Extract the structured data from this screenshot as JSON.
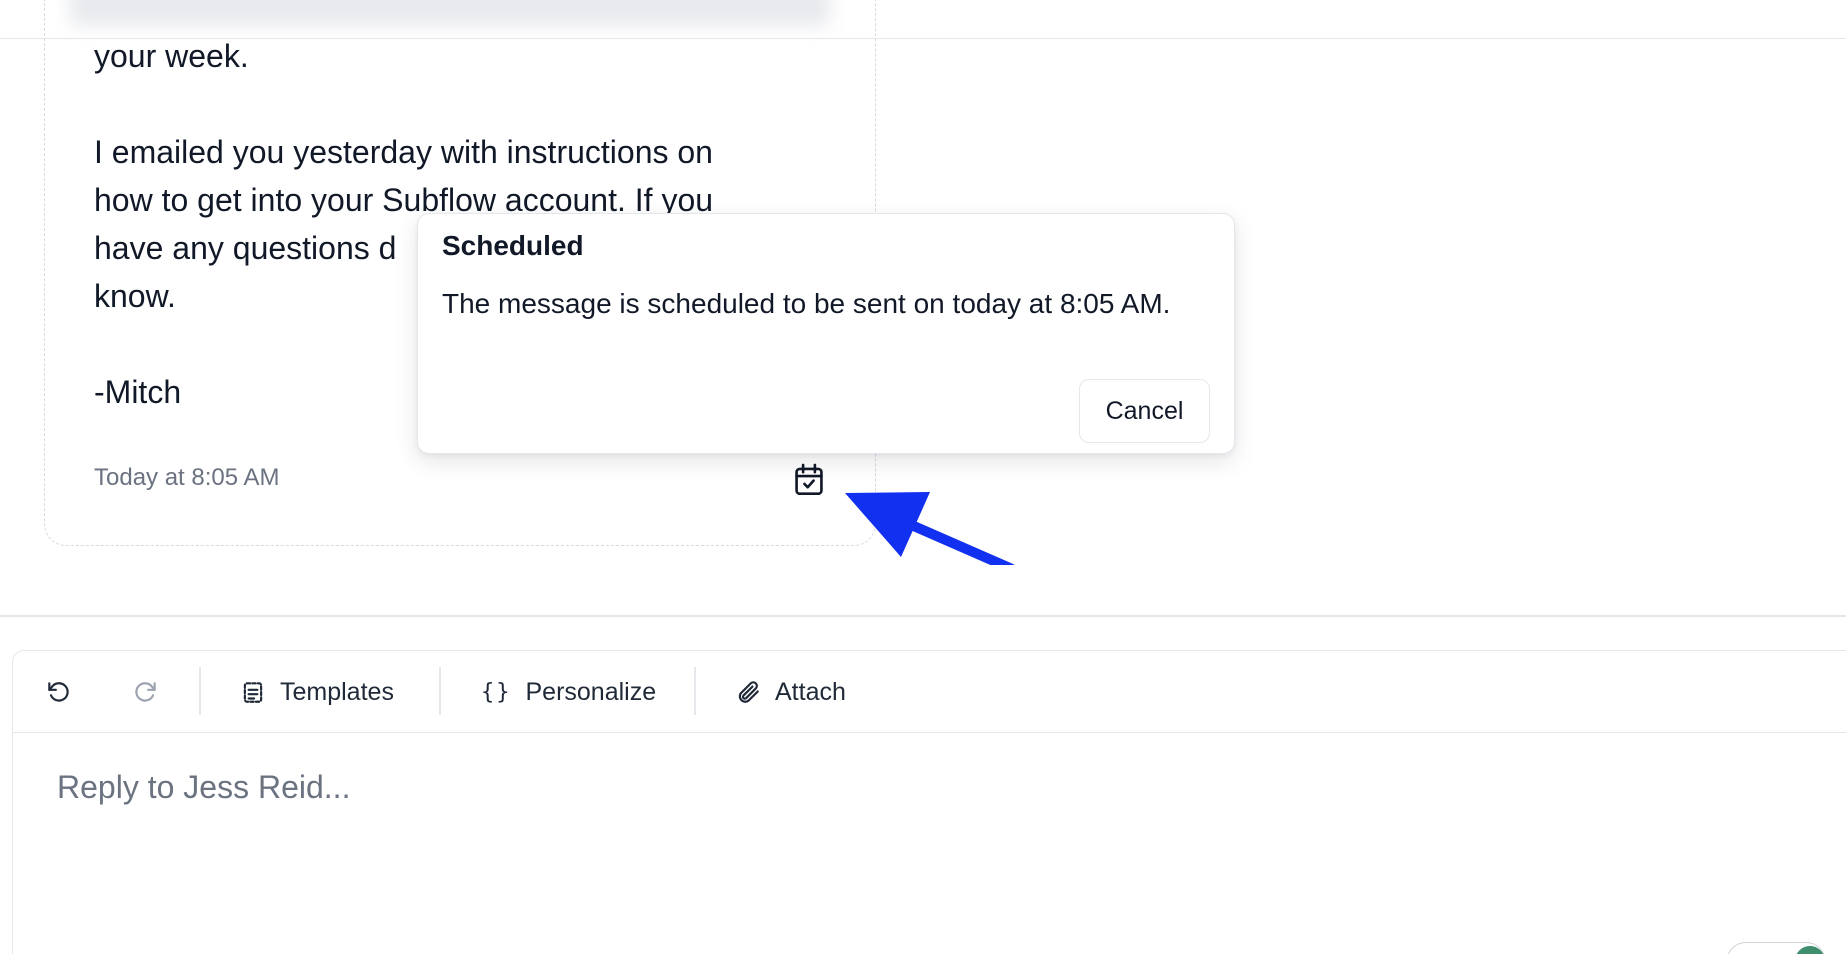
{
  "message": {
    "lines": [
      "your week.",
      "",
      "I emailed you yesterday with instructions on",
      "how to get into your Subflow account. If you",
      "have any questions d",
      "know.",
      "",
      "-Mitch"
    ],
    "timestamp": "Today at 8:05 AM",
    "schedule_icon": "calendar-check-icon"
  },
  "popover": {
    "title": "Scheduled",
    "text": "The message is scheduled to be sent on today at 8:05 AM.",
    "cancel_label": "Cancel"
  },
  "toolbar": {
    "undo_icon": "undo-icon",
    "redo_icon": "redo-icon",
    "templates_label": "Templates",
    "personalize_label": "Personalize",
    "attach_label": "Attach"
  },
  "reply": {
    "placeholder": "Reply to Jess Reid..."
  },
  "colors": {
    "arrow": "#1230f0",
    "muted_text": "#6b7280",
    "border": "#e5e7eb",
    "avatar_green": "#3f8f6f"
  }
}
